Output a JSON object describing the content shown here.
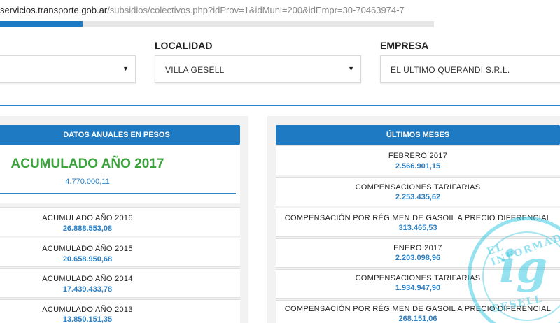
{
  "browser": {
    "url_host": "servicios.transporte.gob.ar",
    "url_path": "/subsidios/colectivos.php?idProv=1&idMuni=200&idEmpr=30-70463974-7"
  },
  "progress": {
    "value": 0.19
  },
  "filters": {
    "first_value": "",
    "localidad_label": "LOCALIDAD",
    "localidad_value": "VILLA GESELL",
    "empresa_label": "EMPRESA",
    "empresa_value": "EL ULTIMO QUERANDI S.R.L."
  },
  "anuales": {
    "header": "DATOS ANUALES EN PESOS",
    "accumulated_title": "ACUMULADO AÑO 2017",
    "accumulated_value": "4.770.000,11",
    "rows": [
      {
        "label": "ACUMULADO AÑO 2016",
        "value": "26.888.553,08"
      },
      {
        "label": "ACUMULADO AÑO 2015",
        "value": "20.658.950,68"
      },
      {
        "label": "ACUMULADO AÑO 2014",
        "value": "17.439.433,78"
      },
      {
        "label": "ACUMULADO AÑO 2013",
        "value": "13.850.151,35"
      }
    ]
  },
  "meses": {
    "header": "ÚLTIMOS MESES",
    "rows": [
      {
        "label": "FEBRERO 2017",
        "value": "2.566.901,15"
      },
      {
        "label": "COMPENSACIONES TARIFARIAS",
        "value": "2.253.435,62"
      },
      {
        "label": "COMPENSACIÓN POR RÉGIMEN DE GASOIL A PRECIO DIFERENCIAL",
        "value": "313.465,53"
      },
      {
        "label": "ENERO 2017",
        "value": "2.203.098,96"
      },
      {
        "label": "COMPENSACIONES TARIFARIAS",
        "value": "1.934.947,90"
      },
      {
        "label": "COMPENSACIÓN POR RÉGIMEN DE GASOIL A PRECIO DIFERENCIAL",
        "value": "268.151,06"
      }
    ]
  },
  "watermark": {
    "mark": "ig",
    "top_text": "EL INFORMAD",
    "bottom_text": "GESELL",
    "color": "#3cc8e1"
  },
  "colors": {
    "accent": "#1e7ac2",
    "green": "#3aa33b",
    "value_blue": "#2a7fc4"
  }
}
